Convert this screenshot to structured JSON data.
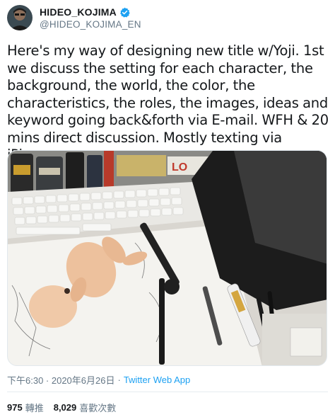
{
  "tweet": {
    "author": {
      "display_name": "HIDEO_KOJIMA",
      "handle": "@HIDEO_KOJIMA_EN",
      "verified": true,
      "avatar_icon": "profile-photo"
    },
    "text": "Here's my way of designing new title w/Yoji. 1st we discuss the setting for each character, the background, the world, the color, the characteristics, the roles, the images, ideas and keyword going back&forth via E-mail. WFH & 20 mins direct discussion. Mostly texting via iPhone.",
    "media": {
      "photo_icon": "desk-photo"
    },
    "timestamp": "下午6:30 · 2020年6月26日",
    "separator": "·",
    "source": "Twitter Web App",
    "stats": {
      "retweets": "975",
      "retweets_label": "轉推",
      "likes": "8,029",
      "likes_label": "喜歡次數"
    }
  },
  "colors": {
    "text": "#14171a",
    "secondary": "#657786",
    "link": "#1da1f2",
    "verified": "#1da1f2",
    "divider": "#e6ecf0"
  }
}
